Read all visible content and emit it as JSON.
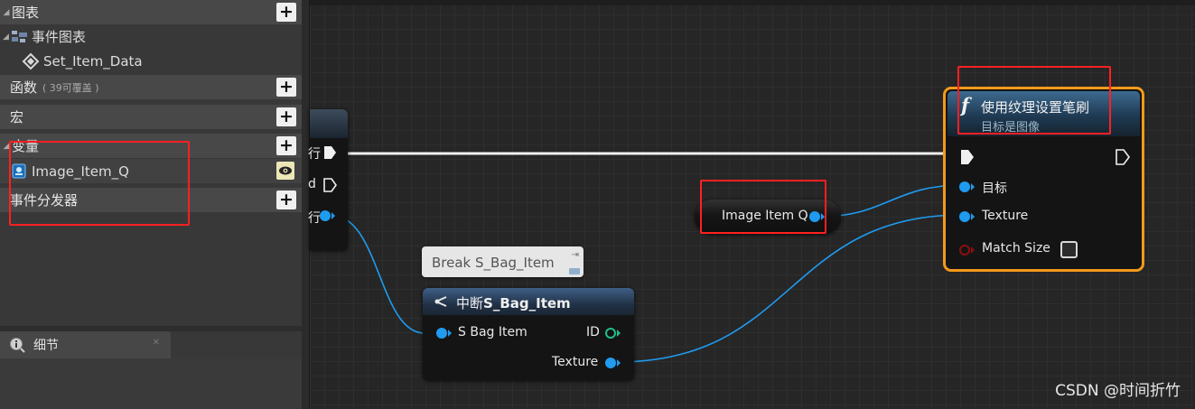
{
  "left_panel": {
    "graphs": {
      "label": "图表"
    },
    "event_graph": {
      "label": "事件图表"
    },
    "set_item_data": {
      "label": "Set_Item_Data"
    },
    "functions": {
      "label": "函数",
      "sub": "( 39可覆盖 )"
    },
    "macros": {
      "label": "宏"
    },
    "variables": {
      "label": "变量"
    },
    "variable_item": {
      "label": "Image_Item_Q"
    },
    "event_dispatchers": {
      "label": "事件分发器"
    },
    "details_tab": {
      "label": "细节"
    }
  },
  "graph": {
    "left_node": {
      "exec_label": "行",
      "pin2_label": "d",
      "pin3_label": "行"
    },
    "break_tooltip": "Break S_Bag_Item",
    "break_node": {
      "title_prefix": "中断",
      "title_main": "S_Bag_Item",
      "input_label": "S Bag Item",
      "out_id_label": "ID",
      "out_texture_label": "Texture"
    },
    "image_var_node": {
      "label": "Image Item Q"
    },
    "brush_node": {
      "title": "使用纹理设置笔刷",
      "subtitle": "目标是图像",
      "target_label": "目标",
      "texture_label": "Texture",
      "match_size_label": "Match Size"
    }
  },
  "watermark": "CSDN @时间折竹",
  "colors": {
    "object_pin": "#1f9bf0",
    "int_pin": "#1fbf8a",
    "bool_pin": "#8a0f0f",
    "highlight": "#ff2020",
    "selected_border": "#f39a1a"
  }
}
